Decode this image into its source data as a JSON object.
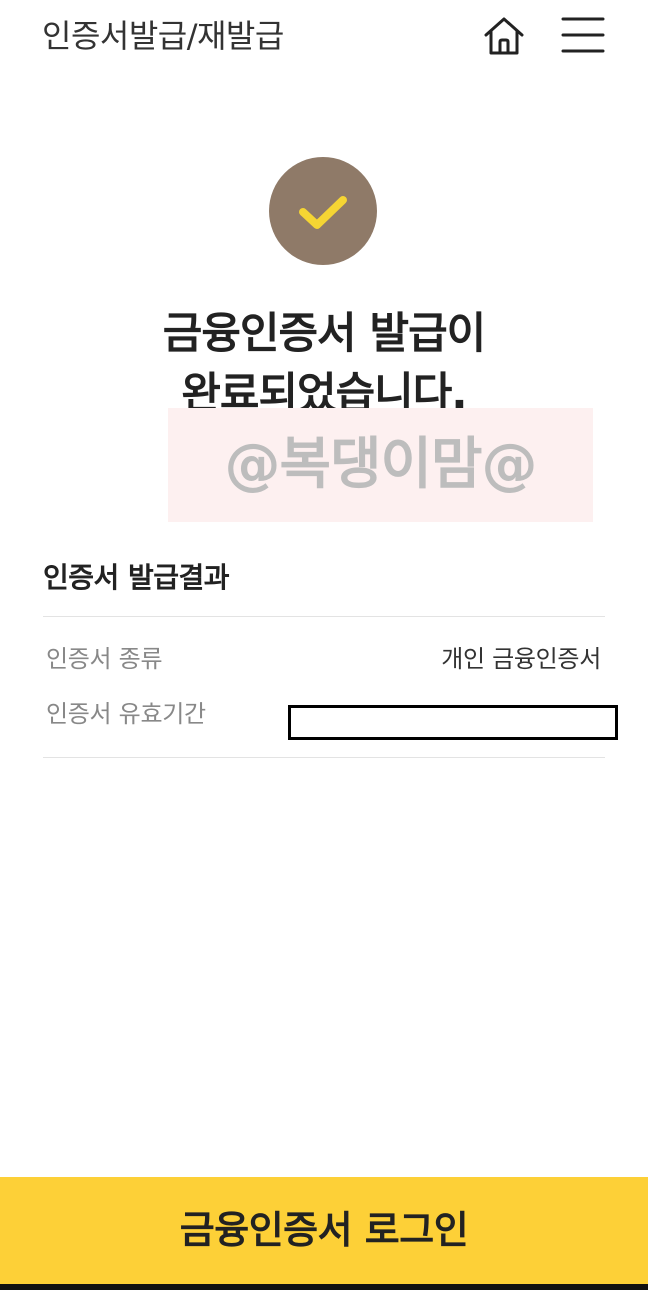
{
  "header": {
    "title": "인증서발급/재발급",
    "home_icon": "home-icon",
    "menu_icon": "hamburger-menu-icon"
  },
  "status": {
    "icon": "check-icon",
    "circle_color": "#8f7a68",
    "check_color": "#f5d533",
    "headline_line1": "금융인증서 발급이",
    "headline_line2": "완료되었습니다."
  },
  "watermark": {
    "text": "@복댕이맘@"
  },
  "result": {
    "title": "인증서 발급결과",
    "rows": [
      {
        "label": "인증서 종류",
        "value": "개인 금융인증서"
      },
      {
        "label": "인증서 유효기간",
        "value": ""
      }
    ]
  },
  "cta": {
    "label": "금융인증서 로그인",
    "color": "#fdd037"
  }
}
